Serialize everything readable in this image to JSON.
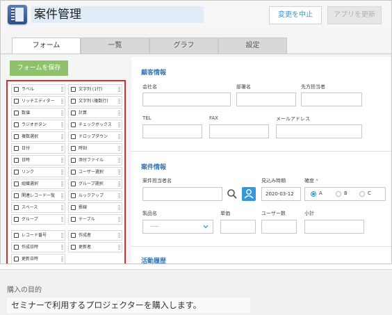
{
  "header": {
    "app_title": "案件管理",
    "cancel_label": "変更を中止",
    "update_label": "アプリを更新"
  },
  "tabs": [
    {
      "label": "フォーム",
      "active": true
    },
    {
      "label": "一覧",
      "active": false
    },
    {
      "label": "グラフ",
      "active": false
    },
    {
      "label": "設定",
      "active": false
    }
  ],
  "palette": {
    "save_label": "フォームを保存",
    "items": [
      {
        "label": "ラベル",
        "icon": "tag-icon"
      },
      {
        "label": "文字列 (1行)",
        "icon": "text-single-line-icon"
      },
      {
        "label": "リッチエディター",
        "icon": "rich-editor-icon"
      },
      {
        "label": "文字列 (複数行)",
        "icon": "text-multi-line-icon"
      },
      {
        "label": "数値",
        "icon": "number-icon"
      },
      {
        "label": "計算",
        "icon": "calculator-icon"
      },
      {
        "label": "ラジオボタン",
        "icon": "radio-icon"
      },
      {
        "label": "チェックボックス",
        "icon": "checkbox-icon"
      },
      {
        "label": "複数選択",
        "icon": "multi-select-icon"
      },
      {
        "label": "ドロップダウン",
        "icon": "dropdown-icon"
      },
      {
        "label": "日付",
        "icon": "calendar-icon"
      },
      {
        "label": "時刻",
        "icon": "clock-icon"
      },
      {
        "label": "日時",
        "icon": "datetime-icon"
      },
      {
        "label": "添付ファイル",
        "icon": "paperclip-icon"
      },
      {
        "label": "リンク",
        "icon": "globe-icon"
      },
      {
        "label": "ユーザー選択",
        "icon": "user-icon"
      },
      {
        "label": "組織選択",
        "icon": "organization-icon"
      },
      {
        "label": "グループ選択",
        "icon": "group-icon"
      },
      {
        "label": "関連レコード一覧",
        "icon": "related-records-icon"
      },
      {
        "label": "ルックアップ",
        "icon": "lookup-icon"
      },
      {
        "label": "スペース",
        "icon": "space-icon"
      },
      {
        "label": "罫線",
        "icon": "line-icon"
      },
      {
        "label": "グループ",
        "icon": "group-field-icon"
      },
      {
        "label": "テーブル",
        "icon": "table-icon"
      }
    ],
    "system_items": [
      {
        "label": "レコード番号",
        "icon": "record-number-icon"
      },
      {
        "label": "作成者",
        "icon": "user-icon"
      },
      {
        "label": "作成日時",
        "icon": "calendar-icon"
      },
      {
        "label": "更新者",
        "icon": "user-icon"
      },
      {
        "label": "更新日時",
        "icon": "calendar-icon"
      }
    ]
  },
  "form": {
    "customer_section": "顧客情報",
    "company_label": "会社名",
    "department_label": "部署名",
    "contact_label": "先方担当者",
    "tel_label": "TEL",
    "fax_label": "FAX",
    "email_label": "メールアドレス",
    "deal_section": "案件情報",
    "owner_label": "案件担当者名",
    "expected_date_label": "見込み時期",
    "expected_date_value": "2020-03-12",
    "certainty_label": "確度",
    "required_mark": "*",
    "certainty_options": [
      "A",
      "B",
      "C"
    ],
    "product_label": "製品名",
    "product_placeholder": "-----",
    "unit_price_label": "単価",
    "user_count_label": "ユーザー数",
    "subtotal_label": "小計",
    "activity_section": "活動履歴"
  },
  "bottom": {
    "purpose_label": "購入の目的",
    "purpose_text": "セミナーで利用するプロジェクターを購入します。"
  }
}
